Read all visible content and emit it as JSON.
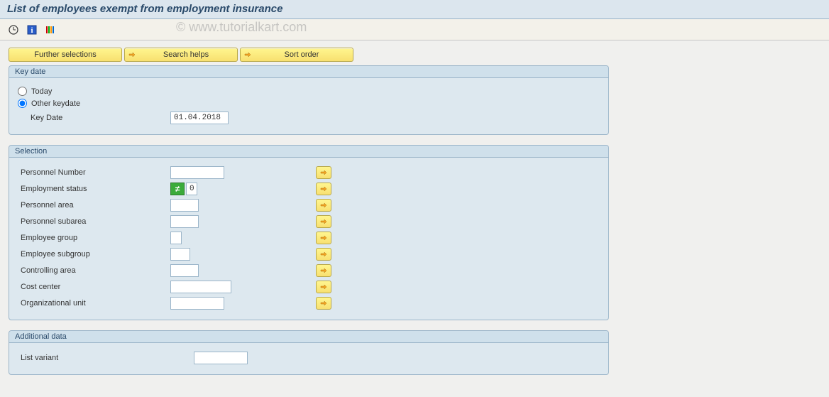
{
  "title": "List of employees exempt from employment insurance",
  "watermark": "© www.tutorialkart.com",
  "buttons": {
    "further_selections": "Further selections",
    "search_helps": "Search helps",
    "sort_order": "Sort order"
  },
  "groups": {
    "key_date": {
      "header": "Key date",
      "radios": {
        "today": "Today",
        "other": "Other keydate"
      },
      "key_date_label": "Key Date",
      "key_date_value": "01.04.2018"
    },
    "selection": {
      "header": "Selection",
      "fields": {
        "personnel_number": {
          "label": "Personnel Number",
          "value": ""
        },
        "employment_status": {
          "label": "Employment status",
          "value": "0"
        },
        "personnel_area": {
          "label": "Personnel area",
          "value": ""
        },
        "personnel_subarea": {
          "label": "Personnel subarea",
          "value": ""
        },
        "employee_group": {
          "label": "Employee group",
          "value": ""
        },
        "employee_subgroup": {
          "label": "Employee subgroup",
          "value": ""
        },
        "controlling_area": {
          "label": "Controlling area",
          "value": ""
        },
        "cost_center": {
          "label": "Cost center",
          "value": ""
        },
        "organizational_unit": {
          "label": "Organizational unit",
          "value": ""
        }
      }
    },
    "additional_data": {
      "header": "Additional data",
      "list_variant_label": "List variant",
      "list_variant_value": ""
    }
  }
}
